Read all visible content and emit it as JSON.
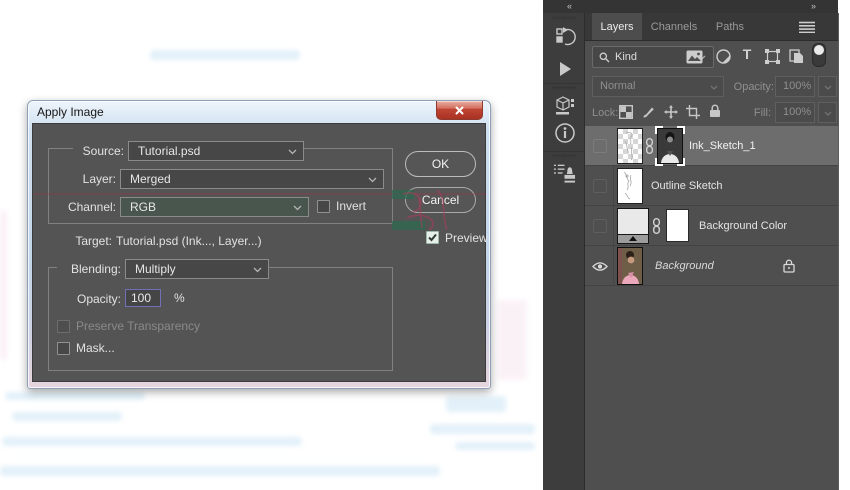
{
  "dialog": {
    "title": "Apply Image",
    "source_label": "Source:",
    "source_value": "Tutorial.psd",
    "layer_label": "Layer:",
    "layer_value": "Merged",
    "channel_label": "Channel:",
    "channel_value": "RGB",
    "invert_label": "Invert",
    "target_label": "Target:",
    "target_value": "Tutorial.psd (Ink..., Layer...)",
    "blending_label": "Blending:",
    "blending_value": "Multiply",
    "opacity_label": "Opacity:",
    "opacity_value": "100",
    "opacity_unit": "%",
    "preserve_transparency_label": "Preserve Transparency",
    "mask_label": "Mask...",
    "ok_label": "OK",
    "cancel_label": "Cancel",
    "preview_label": "Preview"
  },
  "dock": {
    "collapse_glyph": "«",
    "expand_glyph": "»"
  },
  "panel": {
    "tabs": [
      {
        "label": "Layers",
        "active": true
      },
      {
        "label": "Channels",
        "active": false
      },
      {
        "label": "Paths",
        "active": false
      }
    ],
    "filter_kind_label": "Kind",
    "type_filter_glyph": "T",
    "blend_mode_value": "Normal",
    "opacity_label": "Opacity:",
    "opacity_value": "100%",
    "lock_label": "Lock:",
    "fill_label": "Fill:",
    "fill_value": "100%",
    "layers": [
      {
        "name": "Ink_Sketch_1",
        "selected": true,
        "visible": false,
        "linked": true,
        "has_mask": true
      },
      {
        "name": "Outline Sketch",
        "selected": false,
        "visible": false,
        "linked": false,
        "has_mask": false
      },
      {
        "name": "Background Color",
        "selected": false,
        "visible": false,
        "linked": true,
        "has_mask": true
      },
      {
        "name": "Background",
        "selected": false,
        "visible": true,
        "linked": false,
        "locked": true
      }
    ]
  },
  "colors": {
    "panel_bg": "#4f4f4f",
    "selected_row_bg": "#6d6d6d",
    "dialog_bg": "#545454",
    "titlebar_tint": "#c3d5e9",
    "close_button_red": "#bf4434",
    "focus_border_blue": "#7070b6",
    "tab_active_bg": "#4d4d4d"
  }
}
